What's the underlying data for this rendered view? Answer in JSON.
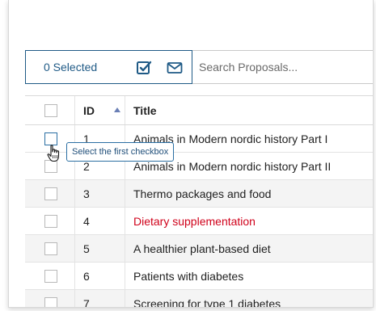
{
  "toolbar": {
    "selected_label": "0 Selected",
    "select_icon": "check-square-icon",
    "mail_icon": "mail-icon"
  },
  "search": {
    "placeholder": "Search Proposals..."
  },
  "table": {
    "columns": [
      "ID",
      "Title"
    ],
    "sort": {
      "column": "ID",
      "direction": "ascending"
    },
    "rows": [
      {
        "id": "1",
        "title": "Animals in Modern nordic history Part I"
      },
      {
        "id": "2",
        "title": "Animals in Modern nordic history Part II"
      },
      {
        "id": "3",
        "title": "Thermo packages and food"
      },
      {
        "id": "4",
        "title": "Dietary supplementation",
        "color": "#d0021b"
      },
      {
        "id": "5",
        "title": "A healthier plant-based diet"
      },
      {
        "id": "6",
        "title": "Patients with diabetes"
      },
      {
        "id": "7",
        "title": "Screening for type 1 diabetes"
      }
    ]
  },
  "tooltip": {
    "text": "Select the first checkbox"
  },
  "colors": {
    "accent": "#1f5a86",
    "tooltip_border": "#2b6fa3",
    "highlight_text": "#d0021b"
  }
}
